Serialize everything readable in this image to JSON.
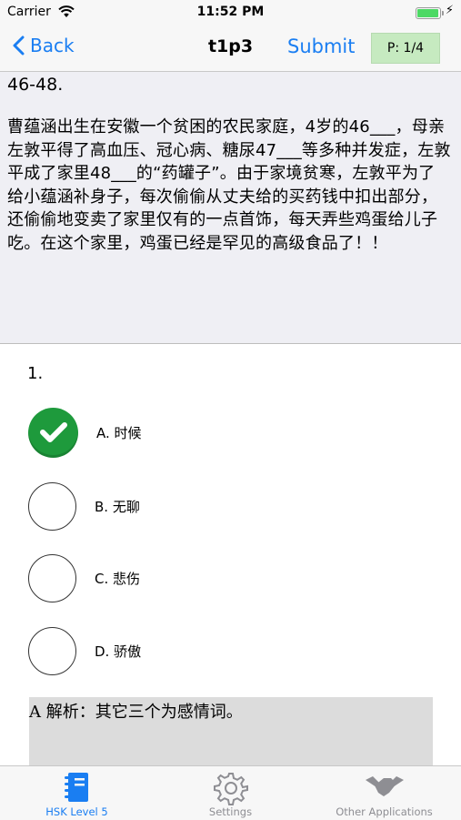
{
  "status_bar": {
    "carrier": "Carrier",
    "time": "11:52 PM"
  },
  "nav": {
    "back_label": "Back",
    "title": "t1p3",
    "submit_label": "Submit",
    "page_indicator": "P: 1/4"
  },
  "passage": {
    "heading": "46-48.",
    "text": "曹蕴涵出生在安徽一个贫困的农民家庭，4岁的46___，母亲左敦平得了高血压、冠心病、糖尿47___等多种并发症，左敦平成了家里48___的“药罐子”。由于家境贫寒，左敦平为了给小蕴涵补身子，每次偷偷从丈夫给的买药钱中扣出部分，还偷偷地变卖了家里仅有的一点首饰，每天弄些鸡蛋给儿子吃。在这个家里，鸡蛋已经是罕见的高级食品了！！"
  },
  "question": {
    "number": "1.",
    "options": [
      {
        "label": "A. 时候",
        "selected": true
      },
      {
        "label": "B. 无聊",
        "selected": false
      },
      {
        "label": "C. 悲伤",
        "selected": false
      },
      {
        "label": "D. 骄傲",
        "selected": false
      }
    ],
    "explanation": "A 解析：其它三个为感情词。"
  },
  "tabbar": {
    "tabs": [
      {
        "label": "HSK Level 5",
        "icon": "notebook-icon",
        "active": true
      },
      {
        "label": "Settings",
        "icon": "gear-icon",
        "active": false
      },
      {
        "label": "Other Applications",
        "icon": "handshake-icon",
        "active": false
      }
    ]
  },
  "colors": {
    "accent": "#1a7ef2",
    "selected_green": "#1e9a3c",
    "page_badge_bg": "#c6eac0"
  }
}
